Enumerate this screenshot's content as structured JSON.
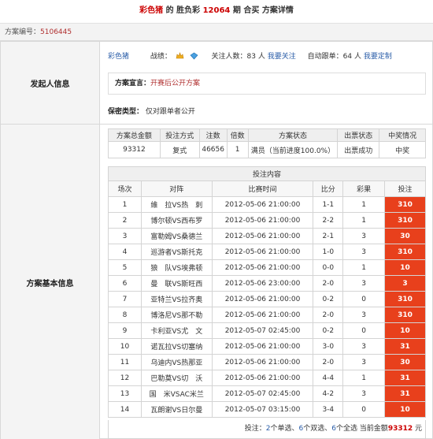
{
  "header": {
    "brand": "彩色猪",
    "mid1": " 的 胜负彩 ",
    "issue": "12064",
    "mid2": " 期 合买 方案详情"
  },
  "case": {
    "label": "方案编号：",
    "number": "5106445"
  },
  "sections": {
    "initiator": "发起人信息",
    "basic": "方案基本信息"
  },
  "initiator": {
    "name": "彩色猪",
    "record_label": "战绩：",
    "follow_label": "关注人数：",
    "follow_count": "83",
    "follow_unit": " 人 ",
    "follow_link": "我要关注",
    "auto_label": "自动跟单：",
    "auto_count": "64",
    "auto_unit": " 人 ",
    "auto_link": "我要定制",
    "declaration_label": "方案宣言：",
    "declaration": "开赛后公开方案",
    "secret_label": "保密类型：",
    "secret_value": "仅对跟单者公开"
  },
  "summary": {
    "headers": [
      "方案总金额",
      "投注方式",
      "注数",
      "倍数",
      "方案状态",
      "出票状态",
      "中奖情况"
    ],
    "row": [
      "93312",
      "复式",
      "46656",
      "1",
      "满员（当前进度100.0%）",
      "出票成功",
      "中奖"
    ]
  },
  "bets": {
    "caption": "投注内容",
    "headers": [
      "场次",
      "对阵",
      "比赛时间",
      "比分",
      "彩果",
      "投注"
    ],
    "rows": [
      [
        "1",
        "維　拉VS热　刺",
        "2012-05-06 21:00:00",
        "1-1",
        "1",
        "310"
      ],
      [
        "2",
        "博尔顿VS西布罗",
        "2012-05-06 21:00:00",
        "2-2",
        "1",
        "310"
      ],
      [
        "3",
        "富勒姆VS桑德兰",
        "2012-05-06 21:00:00",
        "2-1",
        "3",
        "30"
      ],
      [
        "4",
        "巡游者VS斯托克",
        "2012-05-06 21:00:00",
        "1-0",
        "3",
        "310"
      ],
      [
        "5",
        "狼　队VS埃弗顿",
        "2012-05-06 21:00:00",
        "0-0",
        "1",
        "10"
      ],
      [
        "6",
        "曼　联VS斯旺西",
        "2012-05-06 23:00:00",
        "2-0",
        "3",
        "3"
      ],
      [
        "7",
        "亚特兰VS拉齐奥",
        "2012-05-06 21:00:00",
        "0-2",
        "0",
        "310"
      ],
      [
        "8",
        "博洛尼VS那不勒",
        "2012-05-06 21:00:00",
        "2-0",
        "3",
        "310"
      ],
      [
        "9",
        "卡利亚VS尤　文",
        "2012-05-07 02:45:00",
        "0-2",
        "0",
        "10"
      ],
      [
        "10",
        "诺瓦拉VS切塞纳",
        "2012-05-06 21:00:00",
        "3-0",
        "3",
        "31"
      ],
      [
        "11",
        "乌迪内VS热那亚",
        "2012-05-06 21:00:00",
        "2-0",
        "3",
        "30"
      ],
      [
        "12",
        "巴勒莫VS切　沃",
        "2012-05-06 21:00:00",
        "4-4",
        "1",
        "31"
      ],
      [
        "13",
        "国　米VSAC米兰",
        "2012-05-07 02:45:00",
        "4-2",
        "3",
        "31"
      ],
      [
        "14",
        "瓦朗谢VS日尔曼",
        "2012-05-07 03:15:00",
        "3-4",
        "0",
        "10"
      ]
    ]
  },
  "footer": {
    "prefix": "投注：",
    "single_count": "2",
    "single_label": "个单选、",
    "double_count": "6",
    "double_label": "个双选、",
    "full_count": "6",
    "full_label": "个全选 当前金额",
    "amount": "93312",
    "unit": " 元"
  },
  "colors": {
    "accent_red": "#e8401c",
    "link_blue": "#2a5da8",
    "brand_red": "#c00000"
  }
}
